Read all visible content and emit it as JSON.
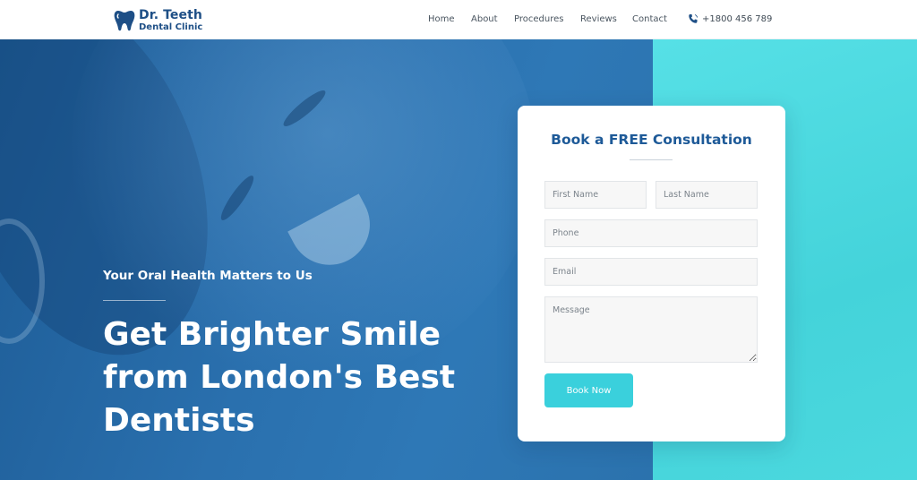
{
  "brand": {
    "title": "Dr. Teeth",
    "subtitle": "Dental Clinic",
    "icon": "tooth-icon",
    "color": "#1e4f86"
  },
  "nav": {
    "items": [
      {
        "label": "Home"
      },
      {
        "label": "About"
      },
      {
        "label": "Procedures"
      },
      {
        "label": "Reviews"
      },
      {
        "label": "Contact"
      }
    ],
    "phone": {
      "icon": "phone-icon",
      "label": "+1800 456 789"
    }
  },
  "hero": {
    "tagline": "Your Oral Health Matters to Us",
    "headline_lines": [
      "Get Brighter Smile",
      "from London's Best",
      "Dentists"
    ],
    "primary_color": "#2a70ae",
    "accent_color": "#4bd8de"
  },
  "form": {
    "title": "Book a FREE Consultation",
    "first_name": {
      "placeholder": "First Name",
      "value": ""
    },
    "last_name": {
      "placeholder": "Last Name",
      "value": ""
    },
    "phone": {
      "placeholder": "Phone",
      "value": ""
    },
    "email": {
      "placeholder": "Email",
      "value": ""
    },
    "message": {
      "placeholder": "Message",
      "value": ""
    },
    "submit_label": "Book Now",
    "button_color": "#3ad0dc"
  }
}
